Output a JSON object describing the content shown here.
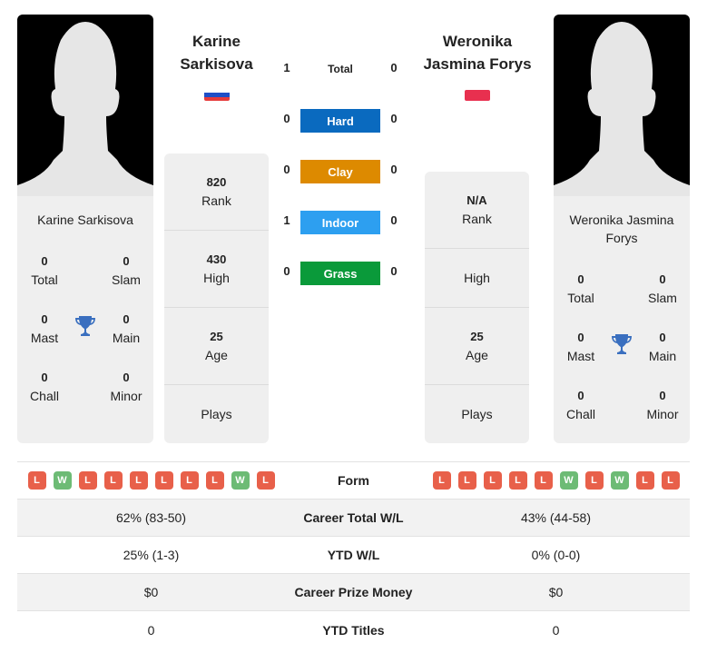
{
  "player1": {
    "name": "Karine Sarkisova",
    "header_name_line1": "Karine",
    "header_name_line2": "Sarkisova",
    "flag": "russia-flag",
    "titles": {
      "total": "0",
      "slam": "0",
      "mast": "0",
      "main": "0",
      "chall": "0",
      "minor": "0"
    },
    "stats": {
      "rank": "820",
      "high": "430",
      "age": "25",
      "plays": ""
    }
  },
  "player2": {
    "name": "Weronika Jasmina Forys",
    "card_name_line1": "Weronika Jasmina",
    "card_name_line2": "Forys",
    "header_name_line1": "Weronika",
    "header_name_line2": "Jasmina Forys",
    "flag": "poland-flag",
    "titles": {
      "total": "0",
      "slam": "0",
      "mast": "0",
      "main": "0",
      "chall": "0",
      "minor": "0"
    },
    "stats": {
      "rank": "N/A",
      "high": "",
      "age": "25",
      "plays": ""
    }
  },
  "labels": {
    "total": "Total",
    "slam": "Slam",
    "mast": "Mast",
    "main": "Main",
    "chall": "Chall",
    "minor": "Minor",
    "rank": "Rank",
    "high": "High",
    "age": "Age",
    "plays": "Plays"
  },
  "h2h": {
    "total": {
      "label": "Total",
      "p1": "1",
      "p2": "0"
    },
    "surfaces": [
      {
        "label": "Hard",
        "p1": "0",
        "p2": "0",
        "color": "#0a6abf"
      },
      {
        "label": "Clay",
        "p1": "0",
        "p2": "0",
        "color": "#dd8a00"
      },
      {
        "label": "Indoor",
        "p1": "1",
        "p2": "0",
        "color": "#2d9ff0"
      },
      {
        "label": "Grass",
        "p1": "0",
        "p2": "0",
        "color": "#0a9a3a"
      }
    ]
  },
  "comparison": {
    "form_label": "Form",
    "p1_form": [
      "L",
      "W",
      "L",
      "L",
      "L",
      "L",
      "L",
      "L",
      "W",
      "L"
    ],
    "p2_form": [
      "L",
      "L",
      "L",
      "L",
      "L",
      "W",
      "L",
      "W",
      "L",
      "L"
    ],
    "rows": [
      {
        "label": "Career Total W/L",
        "p1": "62% (83-50)",
        "p2": "43% (44-58)"
      },
      {
        "label": "YTD W/L",
        "p1": "25% (1-3)",
        "p2": "0% (0-0)"
      },
      {
        "label": "Career Prize Money",
        "p1": "$0",
        "p2": "$0"
      },
      {
        "label": "YTD Titles",
        "p1": "0",
        "p2": "0"
      }
    ]
  }
}
